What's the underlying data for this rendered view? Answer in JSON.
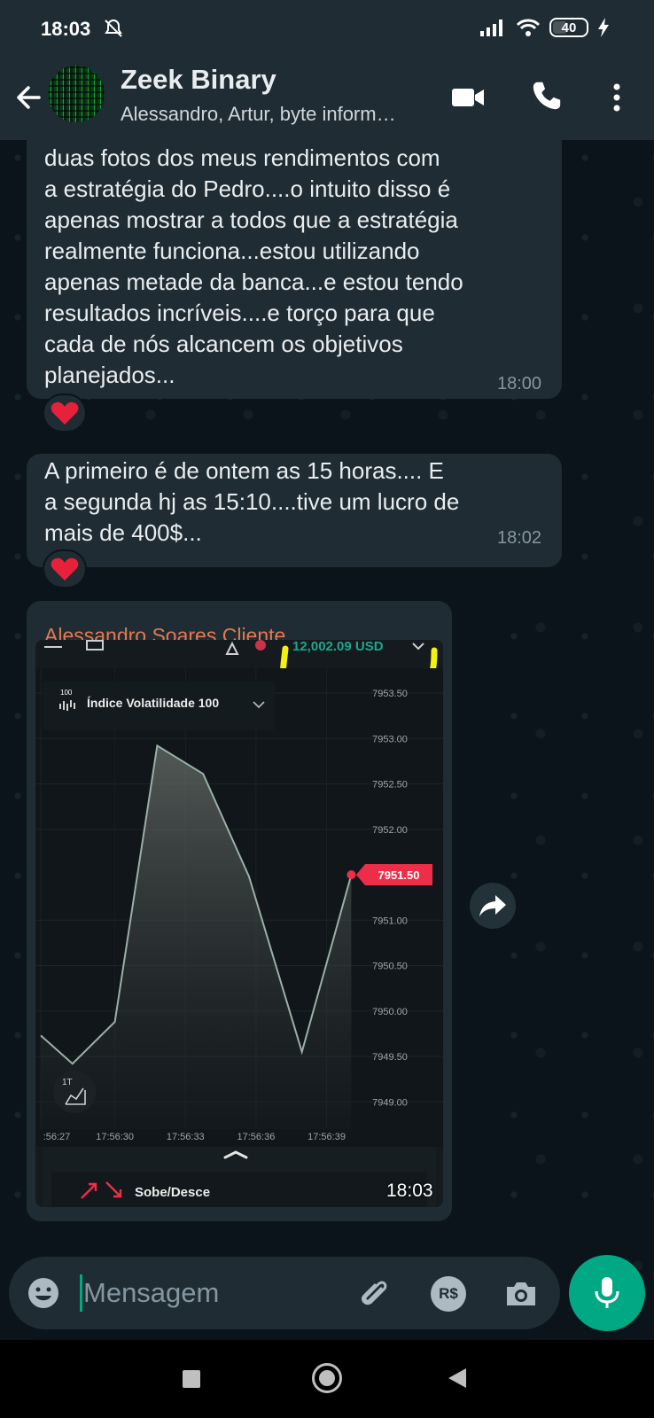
{
  "status_bar": {
    "time": "18:03",
    "battery": "40"
  },
  "header": {
    "title": "Zeek Binary",
    "subtitle": "Alessandro, Artur, byte inform…"
  },
  "messages": [
    {
      "text": "duas fotos dos meus rendimentos com\na estratégia do Pedro....o intuito disso é\napenas mostrar a todos que a estratégia\nrealmente funciona...estou utilizando\napenas metade da banca...e estou tendo\nresultados incríveis....e torço para que\ncada de nós alcancem os objetivos\nplanejados...",
      "time": "18:00",
      "reaction": "heart"
    },
    {
      "text": "A primeiro é de ontem as 15 horas.... E\na segunda hj as 15:10....tive um lucro de\nmais de 400$...",
      "time": "18:02",
      "reaction": "heart"
    }
  ],
  "image_message": {
    "sender": "Alessandro Soares Cliente",
    "time": "18:03",
    "sender_color": "#e6784f"
  },
  "trading_screenshot": {
    "balance": "12,002.09 USD",
    "asset_name": "Índice Volatilidade 100",
    "asset_badge": "100",
    "current_price": "7951.50",
    "timeframe": "1T",
    "trade_type": "Sobe/Desce",
    "highlight_color": "#f2f20a",
    "price_tag_color": "#ee2e48"
  },
  "chart_data": {
    "type": "area",
    "x": [
      ":56:27",
      "17:56:30",
      "17:56:33",
      "17:56:36",
      "17:56:39"
    ],
    "y_ticks": [
      "7953.50",
      "7953.00",
      "7952.50",
      "7952.00",
      "7951.00",
      "7950.50",
      "7950.00",
      "7949.50",
      "7949.00"
    ],
    "ylim": [
      7948.7,
      7953.5
    ],
    "series": [
      {
        "x": [
          0,
          0.9,
          2.1,
          3.3,
          4.6,
          5.9,
          7.4,
          8.8
        ],
        "y": [
          7949.73,
          7949.42,
          7949.88,
          7952.92,
          7952.61,
          7951.48,
          7949.55,
          7951.5
        ]
      }
    ],
    "x_tick_positions": [
      0,
      2.1,
      4.1,
      6.1,
      8.1
    ],
    "xlim": [
      0,
      11.3
    ]
  },
  "composer": {
    "placeholder": "Mensagem",
    "pix_label": "R$"
  }
}
